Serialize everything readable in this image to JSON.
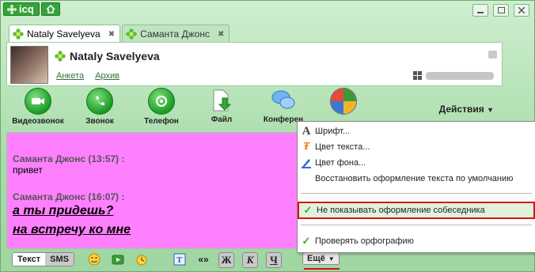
{
  "app": {
    "name": "icq"
  },
  "tabs": [
    {
      "label": "Nataly Savelyeva",
      "close": "✖",
      "active": true
    },
    {
      "label": "Саманта Джонс",
      "close": "✖",
      "active": false
    }
  ],
  "contact": {
    "name": "Nataly Savelyeva",
    "links": [
      "Анкета",
      "Архив"
    ]
  },
  "toolbar": {
    "items": [
      "Видеозвонок",
      "Звонок",
      "Телефон",
      "Файл",
      "Конферен"
    ],
    "actions": "Действия"
  },
  "chat": {
    "messages": [
      {
        "sender": "Саманта Джонс (13:57) :",
        "lines": [
          "привет"
        ]
      },
      {
        "sender": "Саманта Джонс (16:07) :",
        "lines": [
          "а ты придешь?",
          "на встречу ко мне"
        ]
      }
    ],
    "background": "#ff80ff"
  },
  "bottom": {
    "mode_text": "Текст",
    "mode_sms": "SMS",
    "fmt_buttons": [
      "«»",
      "Ж",
      "К",
      "Ч"
    ],
    "more": "Ещё"
  },
  "menu": {
    "items": [
      {
        "label": "Шрифт...",
        "icon": "font-icon"
      },
      {
        "label": "Цвет текста...",
        "icon": "text-color-icon"
      },
      {
        "label": "Цвет фона...",
        "icon": "bg-color-icon"
      },
      {
        "label": "Восстановить оформление текста по умолчанию",
        "icon": ""
      }
    ],
    "hide_formatting": {
      "label": "Не показывать оформление собеседника",
      "checked": true
    },
    "spellcheck": {
      "label": "Проверять орфографию",
      "checked": true
    }
  },
  "colors": {
    "accent": "#35a33b",
    "highlight_border": "#dd1111"
  }
}
